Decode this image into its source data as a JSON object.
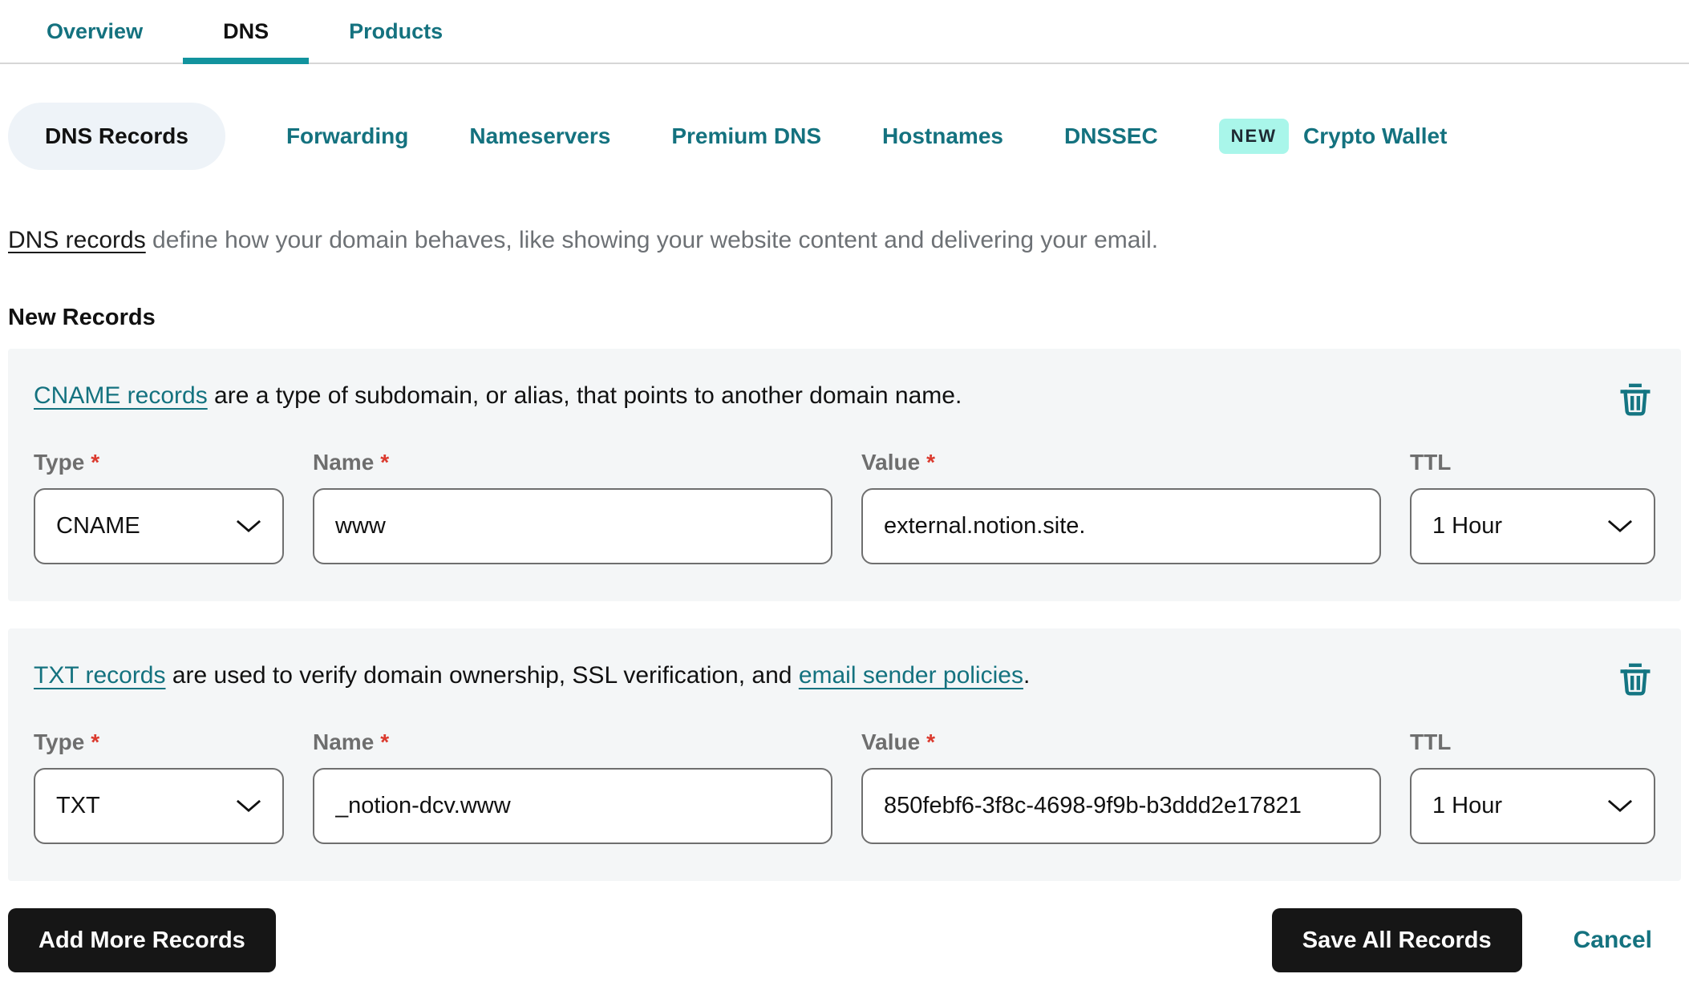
{
  "colors": {
    "teal_link": "#14727f",
    "active_tab_underline": "#12939e",
    "new_badge_bg": "#a9f6ea",
    "card_bg": "#f4f6f7",
    "button_bg": "#161616",
    "required_asterisk": "#db3a2e",
    "muted_text": "#6d7175",
    "input_border": "#6f6f6f"
  },
  "icons": {
    "trash": "trash-icon",
    "chevron": "chevron-down-icon"
  },
  "tabs": {
    "overview": "Overview",
    "dns": "DNS",
    "products": "Products"
  },
  "subtabs": {
    "dns_records": "DNS Records",
    "forwarding": "Forwarding",
    "nameservers": "Nameservers",
    "premium_dns": "Premium DNS",
    "hostnames": "Hostnames",
    "dnssec": "DNSSEC",
    "new_badge": "NEW",
    "crypto_wallet": "Crypto Wallet"
  },
  "intro": {
    "link_text": "DNS records",
    "rest_text": " define how your domain behaves, like showing your website content and delivering your email."
  },
  "section_title": "New Records",
  "field_labels": {
    "type": "Type",
    "name": "Name",
    "value": "Value",
    "ttl": "TTL",
    "required_mark": "*"
  },
  "records": [
    {
      "intro_link": "CNAME records",
      "intro_rest": " are a type of subdomain, or alias, that points to another domain name.",
      "intro_link2": "",
      "intro_rest2": "",
      "type": "CNAME",
      "name": "www",
      "value": "external.notion.site.",
      "ttl": "1 Hour"
    },
    {
      "intro_link": "TXT records",
      "intro_rest": " are used to verify domain ownership, SSL verification, and ",
      "intro_link2": "email sender policies",
      "intro_rest2": ".",
      "type": "TXT",
      "name": "_notion-dcv.www",
      "value": "850febf6-3f8c-4698-9f9b-b3ddd2e17821",
      "ttl": "1 Hour"
    }
  ],
  "actions": {
    "add": "Add More Records",
    "save": "Save All Records",
    "cancel": "Cancel"
  }
}
